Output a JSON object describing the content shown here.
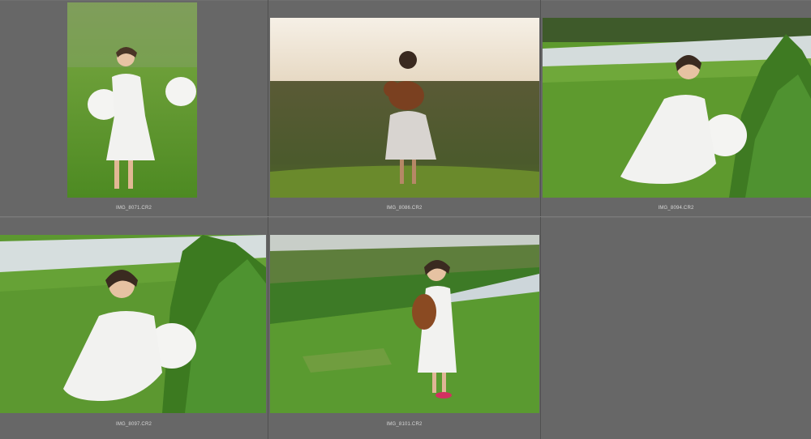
{
  "grid": {
    "cells": [
      {
        "filename": "IMG_8071.CR2",
        "subject": "girl-with-balloons-standing-photo"
      },
      {
        "filename": "IMG_8086.CR2",
        "subject": "girl-with-teddy-bear-backlit-photo"
      },
      {
        "filename": "IMG_8094.CR2",
        "subject": "girl-sitting-with-balloon-photo"
      },
      {
        "filename": "IMG_8097.CR2",
        "subject": "girl-sitting-with-balloon-closeup-photo"
      },
      {
        "filename": "IMG_8101.CR2",
        "subject": "girl-with-teddy-bear-on-hill-photo"
      }
    ]
  },
  "colors": {
    "background": "#5a5a5a",
    "cell": "#676767",
    "filename_text": "#d8d8d8",
    "grass": "#5f9a2e",
    "dress": "#f2f2f0"
  }
}
